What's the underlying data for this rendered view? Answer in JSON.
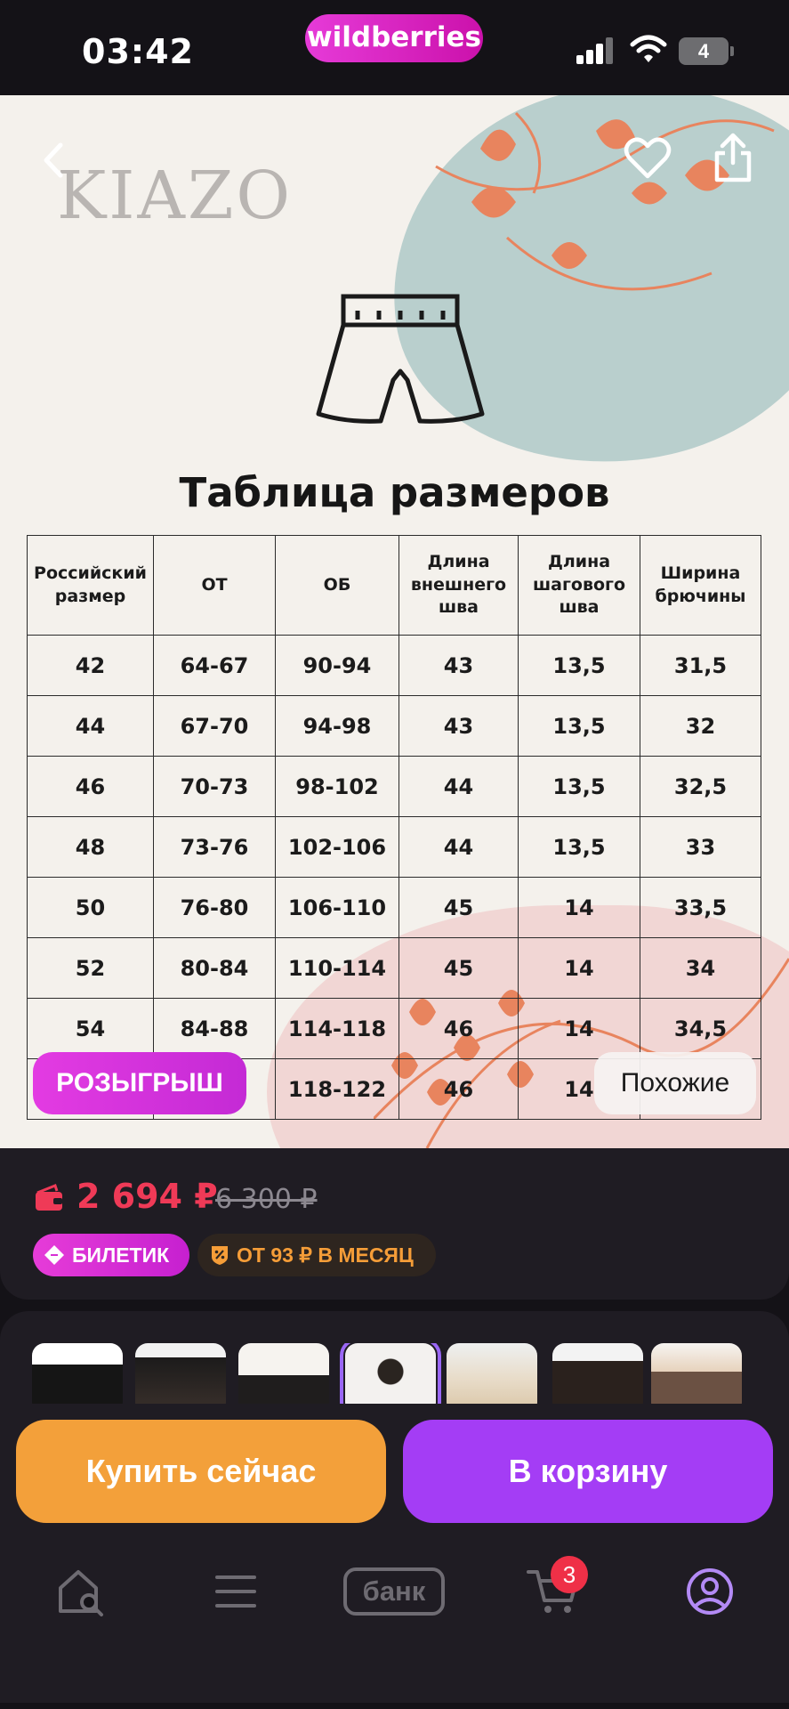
{
  "status_bar": {
    "time": "03:42",
    "app_badge": "wildberries",
    "battery": "4"
  },
  "product_image": {
    "brand": "KIAZO",
    "size_chart_title": "Таблица размеров",
    "table": {
      "headers": [
        "Российский размер",
        "ОТ",
        "ОБ",
        "Длина внешнего шва",
        "Длина шагового шва",
        "Ширина брючины"
      ],
      "rows": [
        [
          "42",
          "64-67",
          "90-94",
          "43",
          "13,5",
          "31,5"
        ],
        [
          "44",
          "67-70",
          "94-98",
          "43",
          "13,5",
          "32"
        ],
        [
          "46",
          "70-73",
          "98-102",
          "44",
          "13,5",
          "32,5"
        ],
        [
          "48",
          "73-76",
          "102-106",
          "44",
          "13,5",
          "33"
        ],
        [
          "50",
          "76-80",
          "106-110",
          "45",
          "14",
          "33,5"
        ],
        [
          "52",
          "80-84",
          "110-114",
          "45",
          "14",
          "34"
        ],
        [
          "54",
          "84-88",
          "114-118",
          "46",
          "14",
          "34,5"
        ],
        [
          "",
          "",
          "118-122",
          "46",
          "14",
          ""
        ]
      ]
    },
    "draw_label": "РОЗЫГРЫШ",
    "similar_label": "Похожие"
  },
  "price_card": {
    "price": "2 694 ₽",
    "old_price": "6 300 ₽",
    "ticket_label": "БИЛЕТИК",
    "installment_label": "ОТ 93 ₽ В МЕСЯЦ"
  },
  "actions": {
    "buy_now": "Купить сейчас",
    "add_to_cart": "В корзину"
  },
  "bottom_nav": {
    "bank_label": "банк",
    "cart_count": "3"
  },
  "colors": {
    "accent_pink": "#cb11ab",
    "price_red": "#ef3a57",
    "buy_orange": "#f3a03a",
    "cart_purple": "#a43df5",
    "installment_orange": "#f59d38"
  }
}
